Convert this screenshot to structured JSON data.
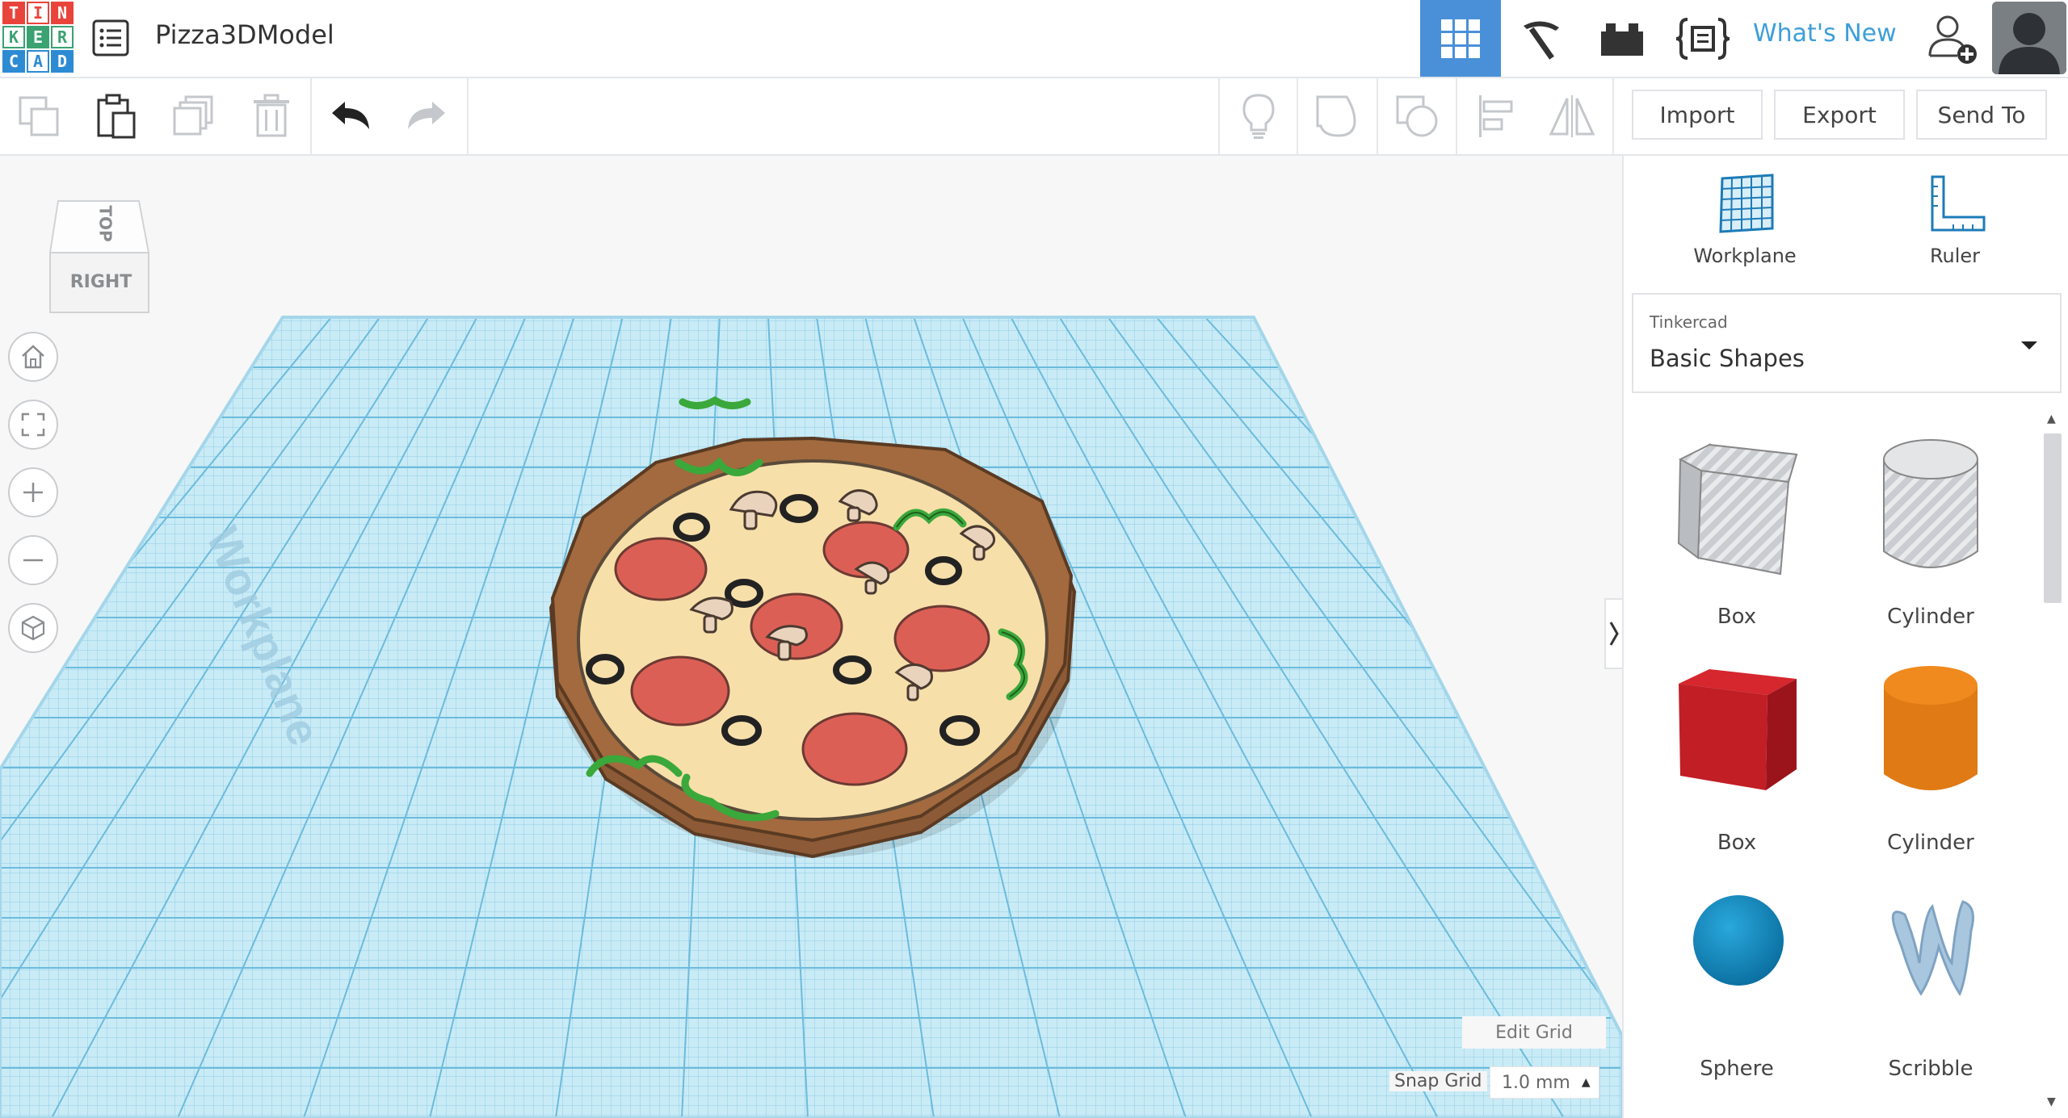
{
  "app": {
    "logo_letters": [
      "T",
      "I",
      "N",
      "K",
      "E",
      "R",
      "C",
      "A",
      "D"
    ],
    "logo_colors": [
      "#e8443b",
      "#e8443b",
      "#e8443b",
      "#3ba272",
      "#3ba272",
      "#3ba272",
      "#2d8bd3",
      "#2d8bd3",
      "#2d8bd3"
    ],
    "project_title": "Pizza3DModel"
  },
  "header": {
    "whats_new": "What's New",
    "accent": "#3d8fd9"
  },
  "toolbar": {
    "import_label": "Import",
    "export_label": "Export",
    "send_to_label": "Send To"
  },
  "viewcube": {
    "top_label": "TOP",
    "right_label": "RIGHT"
  },
  "workplane": {
    "watermark": "Workplane",
    "edit_grid": "Edit Grid",
    "snap_grid_label": "Snap Grid",
    "snap_grid_value": "1.0 mm"
  },
  "panel": {
    "workplane_label": "Workplane",
    "ruler_label": "Ruler",
    "library_provider": "Tinkercad",
    "library_name": "Basic Shapes",
    "shapes": [
      {
        "label": "Box",
        "icon": "box-hole-icon"
      },
      {
        "label": "Cylinder",
        "icon": "cylinder-hole-icon"
      },
      {
        "label": "Box",
        "icon": "box-solid-icon"
      },
      {
        "label": "Cylinder",
        "icon": "cylinder-solid-icon"
      },
      {
        "label": "Sphere",
        "icon": "sphere-icon"
      },
      {
        "label": "Scribble",
        "icon": "scribble-icon"
      }
    ]
  }
}
